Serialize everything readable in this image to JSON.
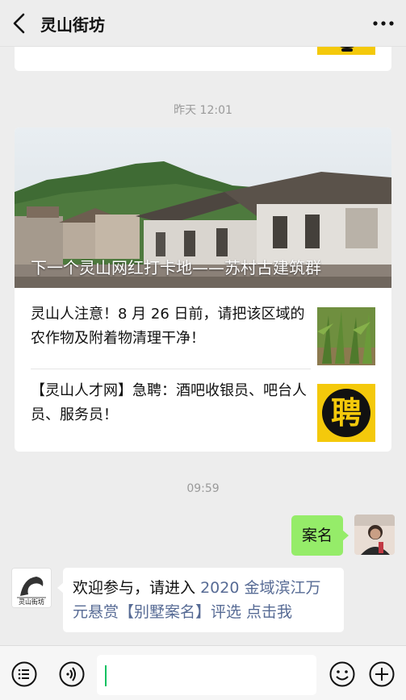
{
  "header": {
    "title": "灵山街坊",
    "back_icon": "chevron-left-icon",
    "more_icon": "more-dots-icon"
  },
  "feed": {
    "timestamp_1": "昨天 12:01",
    "news": {
      "hero_title": "下一个灵山网红打卡地——苏村古建筑群",
      "items": [
        {
          "text": "灵山人注意！8 月 26 日前，请把该区域的农作物及附着物清理干净！",
          "thumb": "crop-field-photo"
        },
        {
          "text": "【灵山人才网】急聘：酒吧收银员、吧台人员、服务员！",
          "thumb": "pin-recruit-icon",
          "thumb_char": "聘"
        }
      ]
    },
    "timestamp_2": "09:59",
    "my_message": "案名",
    "incoming_message": {
      "prefix": "欢迎参与，请进入",
      "link_text": "2020 金域滨江万元悬赏【别墅案名】评选 点击我",
      "avatar_text": "灵山街坊"
    }
  },
  "input_bar": {
    "value": "",
    "icons": [
      "menu-list-icon",
      "voice-icon",
      "emoji-icon",
      "plus-icon"
    ]
  },
  "colors": {
    "background": "#ededed",
    "my_bubble": "#95ec69",
    "link": "#576b95",
    "accent_yellow": "#f4c90b",
    "caret": "#07c160"
  }
}
